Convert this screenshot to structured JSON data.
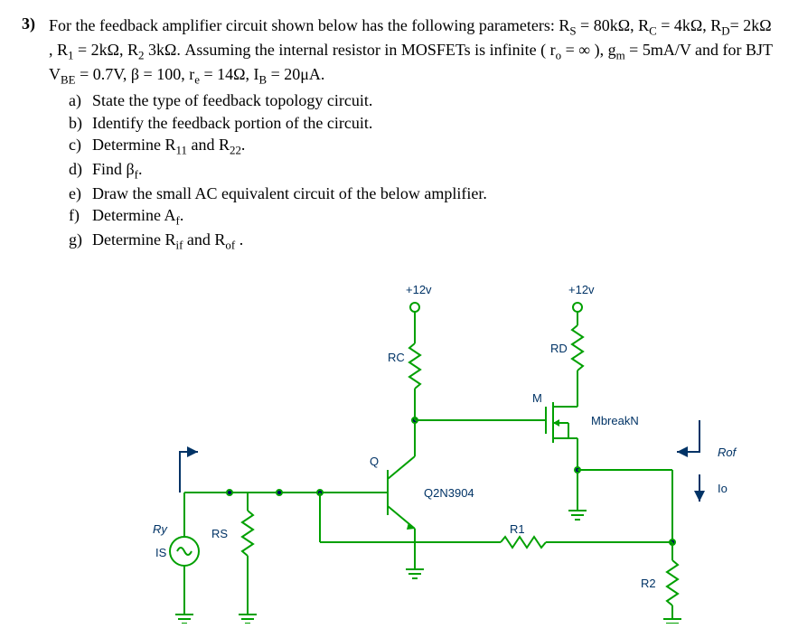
{
  "question": {
    "number": "3)",
    "intro_html": "For the feedback amplifier circuit shown below has the following parameters: R<sub>S</sub> = 80kΩ, R<sub>C</sub> = 4kΩ, R<sub>D</sub>= 2kΩ , R<sub>1</sub> = 2kΩ, R<sub>2</sub> 3kΩ. Assuming the internal resistor in MOSFETs is infinite ( r<sub>o</sub> = ∞ ), g<sub>m</sub> = 5mA/V and for BJT V<sub>BE</sub> = 0.7V, β = 100, r<sub>e</sub> = 14Ω, I<sub>B</sub> = 20μA.",
    "parts": {
      "a": "State the type of feedback topology circuit.",
      "b": "Identify the feedback portion of the circuit.",
      "c": "Determine R<sub>11</sub> and R<sub>22</sub>.",
      "d": "Find β<sub>f</sub>.",
      "e": "Draw the small AC equivalent circuit of the below amplifier.",
      "f": "Determine A<sub>f</sub>.",
      "g": "Determine R<sub>if</sub> and R<sub>of</sub> ."
    }
  },
  "circuit": {
    "supply1": "+12v",
    "supply2": "+12v",
    "labels": {
      "RC": "RC",
      "RD": "RD",
      "R1": "R1",
      "R2": "R2",
      "RS": "RS",
      "M": "M",
      "Q": "Q",
      "IS": "IS",
      "Rof": "Rof",
      "Io": "Io",
      "Ry": "Ry",
      "Mbreak": "MbreakN",
      "QPart": "Q2N3904"
    }
  }
}
